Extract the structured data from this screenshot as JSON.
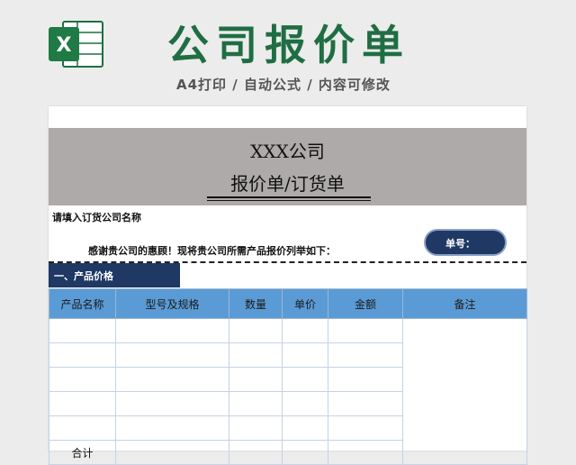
{
  "banner": {
    "title": "公司报价单",
    "subtitle": "A4打印 / 自动公式 / 内容可修改",
    "icon": "excel-icon",
    "brand_color": "#1f6e43"
  },
  "sheet": {
    "company": "XXX公司",
    "doc_title": "报价单/订货单",
    "fill_prompt": "请填入订货公司名称",
    "thanks": "感谢贵公司的惠顾！现将贵公司所需产品报价列举如下：",
    "order_label": "单号：",
    "section": "一、产品价格",
    "columns": [
      "产品名称",
      "型号及规格",
      "数量",
      "单价",
      "金额",
      "备注"
    ],
    "rows": [
      [
        "",
        "",
        "",
        "",
        ""
      ],
      [
        "",
        "",
        "",
        "",
        ""
      ],
      [
        "",
        "",
        "",
        "",
        ""
      ],
      [
        "",
        "",
        "",
        "",
        ""
      ],
      [
        "",
        "",
        "",
        "",
        ""
      ],
      [
        "合计",
        "",
        "",
        "",
        ""
      ]
    ],
    "colors": {
      "title_band": "#aeaaaa",
      "section_bar": "#1f3864",
      "header_row": "#5b9bd5"
    }
  }
}
